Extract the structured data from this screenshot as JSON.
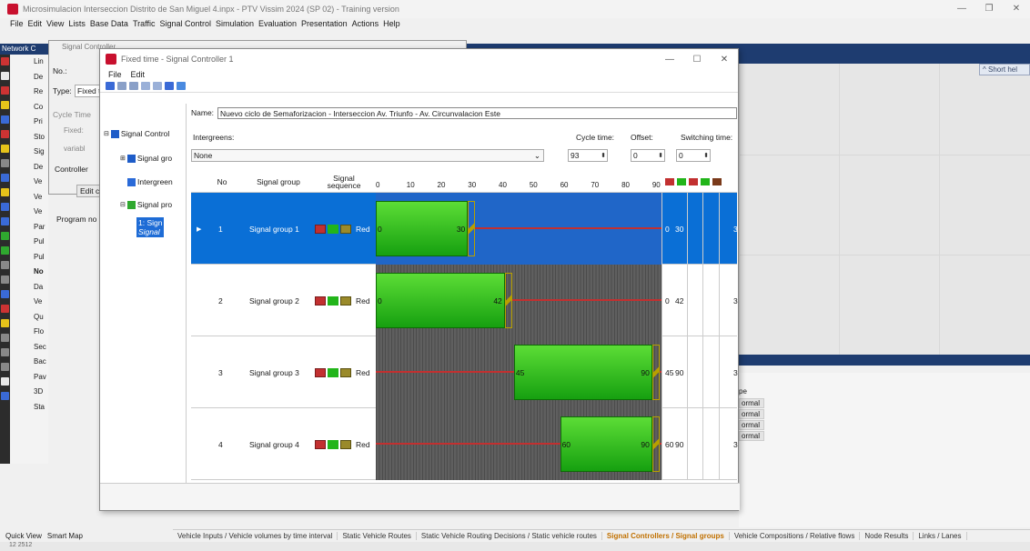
{
  "app": {
    "title": "Microsimulacion Interseccion Distrito de San Miguel 4.inpx - PTV Vissim 2024 (SP 02) - Training version",
    "menu": [
      "File",
      "Edit",
      "View",
      "Lists",
      "Base Data",
      "Traffic",
      "Signal Control",
      "Simulation",
      "Evaluation",
      "Presentation",
      "Actions",
      "Help"
    ],
    "network_label": "Network C",
    "short_help": "^ Short hel",
    "left_items": [
      "Lin",
      "De",
      "Re",
      "Co",
      "Pri",
      "Sto",
      "Sig",
      "De",
      "Ve",
      "Ve",
      "Ve",
      "Par",
      "Pul",
      "Pul",
      "No",
      "Da",
      "Ve",
      "Qu",
      "Flo",
      "Sec",
      "Bac",
      "Pav",
      "3D",
      "Sta"
    ],
    "left_tabs": [
      "Quick View",
      "Smart Map"
    ],
    "network_tab": "Network.",
    "quick_view": "Quick View",
    "status": "12 2512",
    "bottom_tabs": [
      "Vehicle Inputs / Vehicle volumes by time interval",
      "Static Vehicle Routes",
      "Static Vehicle Routing Decisions / Static vehicle routes",
      "Signal Controllers / Signal groups",
      "Vehicle Compositions / Relative flows",
      "Node Results",
      "Links / Lanes"
    ],
    "right_list": {
      "header": "pe",
      "items": [
        "ormal",
        "ormal",
        "ormal",
        "ormal"
      ]
    }
  },
  "signal_controller": {
    "title": "Signal Controller",
    "no_label": "No.:",
    "type_label": "Type:",
    "type_value": "Fixed t",
    "cycle_time_label": "Cycle Time",
    "fixed_label": "Fixed:",
    "variable_label": "variabl",
    "tabs": [
      "Controller",
      "S"
    ],
    "edit_button": "Edit c",
    "program_label": "Program no"
  },
  "fixed_time": {
    "title": "Fixed time - Signal Controller 1",
    "menu": [
      "File",
      "Edit"
    ],
    "name_label": "Name:",
    "name_value": "Nuevo ciclo de Semaforizacion - Interseccion Av. Triunfo - Av. Circunvalacion Este",
    "intergreens_label": "Intergreens:",
    "intergreens_value": "None",
    "cycle_time_label": "Cycle time:",
    "cycle_time": "93",
    "offset_label": "Offset:",
    "offset": "0",
    "switching_label": "Switching time:",
    "switching": "0",
    "tree": {
      "root": "Signal Control",
      "groups": "Signal gro",
      "intergreen": "Intergreen",
      "programs": "Signal pro",
      "program_item_1": "1: Sign",
      "program_item_2": "Signal"
    },
    "columns": {
      "no": "No",
      "group": "Signal group",
      "sequence_1": "Signal",
      "sequence_2": "sequence"
    },
    "time_ticks": [
      "0",
      "10",
      "20",
      "30",
      "40",
      "50",
      "60",
      "70",
      "80",
      "90"
    ],
    "rows": [
      {
        "no": "1",
        "name": "Signal group 1",
        "seq": "Red",
        "green_start": 0,
        "green_end": 30,
        "start_label": "0",
        "end_label": "30",
        "col_a": "0",
        "col_b": "30",
        "col_c": "3"
      },
      {
        "no": "2",
        "name": "Signal group 2",
        "seq": "Red",
        "green_start": 0,
        "green_end": 42,
        "start_label": "0",
        "end_label": "42",
        "col_a": "0",
        "col_b": "42",
        "col_c": "3"
      },
      {
        "no": "3",
        "name": "Signal group 3",
        "seq": "Red",
        "green_start": 45,
        "green_end": 90,
        "start_label": "45",
        "end_label": "90",
        "col_a": "45",
        "col_b": "90",
        "col_c": "3"
      },
      {
        "no": "4",
        "name": "Signal group 4",
        "seq": "Red",
        "green_start": 60,
        "green_end": 90,
        "start_label": "60",
        "end_label": "90",
        "col_a": "60",
        "col_b": "90",
        "col_c": "3"
      }
    ],
    "cycle_max": 93
  }
}
